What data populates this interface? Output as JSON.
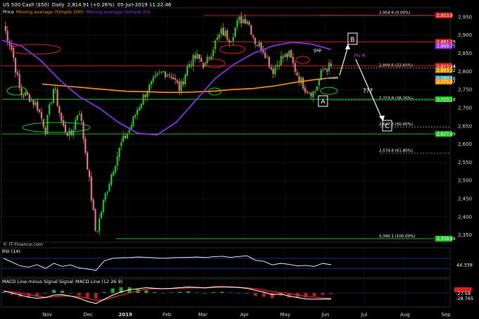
{
  "header": {
    "symbol": "US 500 Cash ($50)",
    "period": "Daily",
    "quote": "2,814.91 (+0.26%)",
    "datetime": "05-Jun-2019 11:22:46"
  },
  "legend": {
    "price": "Price",
    "ma200": "Moving average (Simple 200)",
    "ma50": "Moving average (Simple 50)"
  },
  "watermark": "© IT-Finance.com",
  "colors": {
    "up": "#2fbf2f",
    "down": "#e07a86",
    "ma200": "#ff9900",
    "ma50": "#9b30ff",
    "fib": "#cfcfcf",
    "support": "#22cc22",
    "resistance": "#dd2222",
    "arrow": "#ffffff",
    "current": "#27b6e8"
  },
  "chart_data": [
    {
      "type": "candlestick",
      "title": "US 500 Cash ($50)",
      "ylim": [
        2330,
        2975
      ],
      "y_ticks": [
        2350,
        2400,
        2450,
        2500,
        2550,
        2600,
        2650,
        2700,
        2750,
        2800,
        2850,
        2900,
        2950
      ],
      "x_ticks": [
        "Nov",
        "Dec",
        "2019",
        "Feb",
        "Mar",
        "Apr",
        "May",
        "Jun",
        "Jul",
        "Aug",
        "Sep"
      ],
      "series": [
        {
          "name": "Price",
          "key_closes": [
            2925,
            2860,
            2740,
            2730,
            2705,
            2640,
            2760,
            2650,
            2620,
            2700,
            2540,
            2351,
            2450,
            2530,
            2600,
            2640,
            2700,
            2745,
            2775,
            2800,
            2790,
            2750,
            2820,
            2840,
            2815,
            2870,
            2910,
            2890,
            2940,
            2945,
            2880,
            2860,
            2800,
            2835,
            2845,
            2790,
            2752,
            2740,
            2805,
            2814.9
          ]
        },
        {
          "name": "Moving average (Simple 200)",
          "values": [
            2765,
            2760,
            2755,
            2750,
            2745,
            2744,
            2742,
            2743,
            2745,
            2750,
            2753,
            2760,
            2770,
            2778,
            2784
          ]
        },
        {
          "name": "Moving average (Simple 50)",
          "values": [
            2885,
            2870,
            2830,
            2775,
            2730,
            2700,
            2660,
            2630,
            2625,
            2660,
            2720,
            2780,
            2820,
            2850,
            2870,
            2880,
            2875,
            2860
          ]
        }
      ],
      "fib_levels": [
        {
          "label": "2,954.6 (0.00%)",
          "value": 2954.6
        },
        {
          "label": "2,809.6 (23.60%)",
          "value": 2809.6
        },
        {
          "label": "2,719.8 (38.20%)",
          "value": 2719.8
        },
        {
          "label": "2,647.3 (50.00%)",
          "value": 2647.3
        },
        {
          "label": "2,574.8 (61.80%)",
          "value": 2574.8
        },
        {
          "label": "2,340.1 (100.00%)",
          "value": 2340.1
        }
      ],
      "right_badges": [
        {
          "label": "2,953.9",
          "value": 2953.9,
          "color": "#dd2222"
        },
        {
          "label": "2,881.19",
          "value": 2881.19,
          "color": "#dd2222"
        },
        {
          "label": "2,869.75",
          "value": 2869.75,
          "color": "#9b30ff"
        },
        {
          "label": "2,815.14",
          "value": 2815.14,
          "color": "#dd2222"
        },
        {
          "label": "2,813.44",
          "value": 2813.44,
          "color": "#dd2222"
        },
        {
          "label": "2,803.32",
          "value": 2803.32,
          "color": "#cc8800"
        },
        {
          "label": "2,780.46",
          "value": 2780.46,
          "color": "#27b6e8"
        },
        {
          "label": "2,771.92",
          "value": 2771.92,
          "color": "#ff9900"
        },
        {
          "label": "2,723.18",
          "value": 2723.18,
          "color": "#22cc22"
        },
        {
          "label": "2,627.89",
          "value": 2627.89,
          "color": "#22cc22"
        },
        {
          "label": "2,339.89",
          "value": 2339.89,
          "color": "#22cc22"
        }
      ],
      "annotations": {
        "wave_a": "A",
        "wave_b": "B",
        "wave_c": "C",
        "question": "???",
        "gap": "gap",
        "pivot": "Piv M"
      }
    },
    {
      "type": "line",
      "title": "RSI (14)",
      "ylim": [
        0,
        100
      ],
      "series": [
        {
          "name": "RSI (14)",
          "values": [
            70,
            55,
            40,
            35,
            45,
            30,
            50,
            38,
            44,
            32,
            28,
            22,
            60,
            70,
            72,
            73,
            75,
            74,
            72,
            70,
            72,
            73,
            74,
            75,
            73,
            76,
            78,
            74,
            77,
            80,
            62,
            58,
            44,
            50,
            46,
            40,
            42,
            38,
            50,
            44.34
          ]
        }
      ],
      "current_label": "44.339"
    },
    {
      "type": "line",
      "title": "MACD Line minus Signal Signal",
      "legend2": "MACD Line (12 26 9)",
      "ylim": [
        -60,
        40
      ],
      "series": [
        {
          "name": "MACD Line (12 26 9)",
          "values": [
            10,
            0,
            -10,
            -20,
            -25,
            -22,
            -10,
            -8,
            -15,
            -25,
            -40,
            -50,
            -30,
            -10,
            5,
            15,
            20,
            25,
            22,
            20,
            22,
            25,
            28,
            26,
            24,
            28,
            30,
            28,
            26,
            22,
            12,
            4,
            -8,
            -5,
            -15,
            -22,
            -28,
            -30,
            -29,
            -28.77
          ]
        },
        {
          "name": "Signal",
          "values": [
            8,
            5,
            0,
            -8,
            -15,
            -20,
            -18,
            -14,
            -15,
            -18,
            -25,
            -35,
            -32,
            -22,
            -10,
            0,
            10,
            18,
            20,
            20,
            21,
            22,
            24,
            25,
            24,
            26,
            27,
            27,
            26,
            24,
            20,
            14,
            6,
            2,
            -3,
            -10,
            -16,
            -21,
            -24,
            -26
          ]
        }
      ],
      "current_labels": [
        "-1.1996",
        "-27.58",
        "-28.765"
      ]
    }
  ]
}
